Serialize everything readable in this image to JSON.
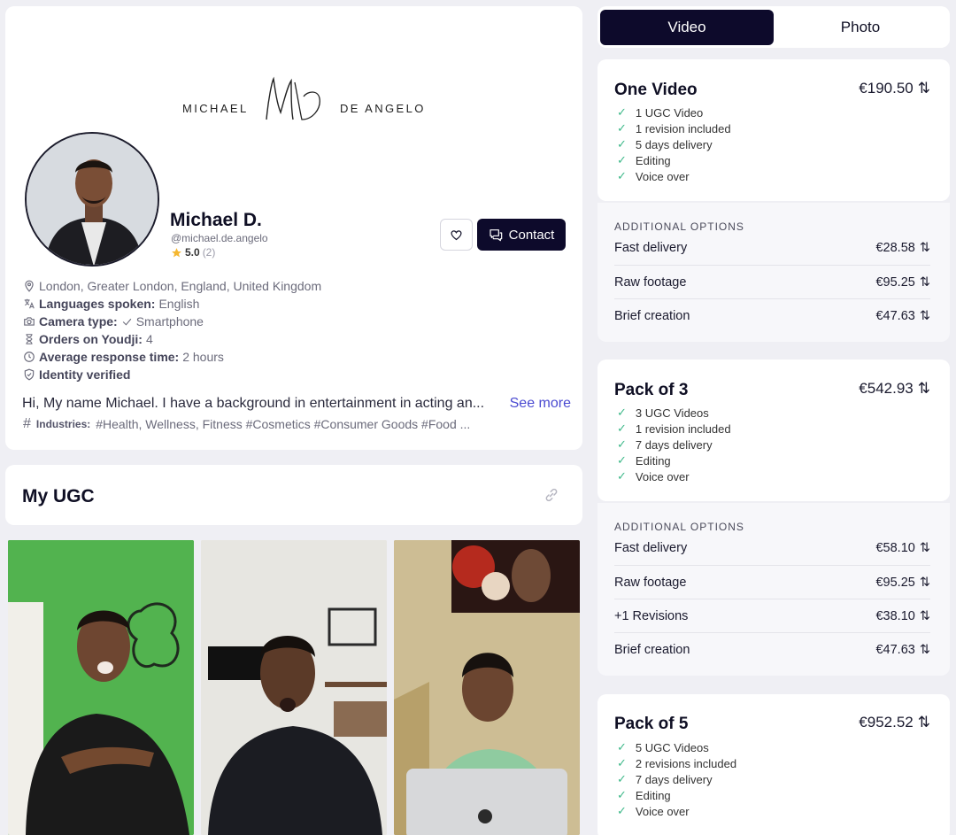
{
  "profile": {
    "logo_left": "MICHAEL",
    "logo_right": "DE ANGELO",
    "name": "Michael D.",
    "handle": "@michael.de.angelo",
    "rating": "5.0",
    "rating_count": "(2)",
    "contact_label": "Contact",
    "location": "London, Greater London, England, United Kingdom",
    "languages_label": "Languages spoken:",
    "languages": "English",
    "camera_label": "Camera type:",
    "camera": "Smartphone",
    "orders_label": "Orders on Youdji:",
    "orders": "4",
    "response_label": "Average response time:",
    "response": "2 hours",
    "verified": "Identity verified",
    "bio": "Hi, My name Michael. I have a background in entertainment in acting an...",
    "see_more": "See more",
    "industries_label": "Industries:",
    "industries": "#Health, Wellness, Fitness #Cosmetics #Consumer Goods #Food ..."
  },
  "ugc": {
    "title": "My UGC"
  },
  "tabs": {
    "video": "Video",
    "photo": "Photo"
  },
  "packages": [
    {
      "title": "One Video",
      "price": "€190.50",
      "features": [
        "1 UGC Video",
        "1 revision included",
        "5 days delivery",
        "Editing",
        "Voice over"
      ],
      "options_header": "ADDITIONAL OPTIONS",
      "options": [
        {
          "label": "Fast delivery",
          "price": "€28.58"
        },
        {
          "label": "Raw footage",
          "price": "€95.25"
        },
        {
          "label": "Brief creation",
          "price": "€47.63"
        }
      ]
    },
    {
      "title": "Pack of 3",
      "price": "€542.93",
      "features": [
        "3 UGC Videos",
        "1 revision included",
        "7 days delivery",
        "Editing",
        "Voice over"
      ],
      "options_header": "ADDITIONAL OPTIONS",
      "options": [
        {
          "label": "Fast delivery",
          "price": "€58.10"
        },
        {
          "label": "Raw footage",
          "price": "€95.25"
        },
        {
          "label": "+1 Revisions",
          "price": "€38.10"
        },
        {
          "label": "Brief creation",
          "price": "€47.63"
        }
      ]
    },
    {
      "title": "Pack of 5",
      "price": "€952.52",
      "features": [
        "5 UGC Videos",
        "2 revisions included",
        "7 days delivery",
        "Editing",
        "Voice over"
      ]
    }
  ],
  "colors": {
    "primary": "#0d0a2b",
    "check": "#3fb98a",
    "link": "#4b4bd1",
    "star": "#f5b731"
  }
}
